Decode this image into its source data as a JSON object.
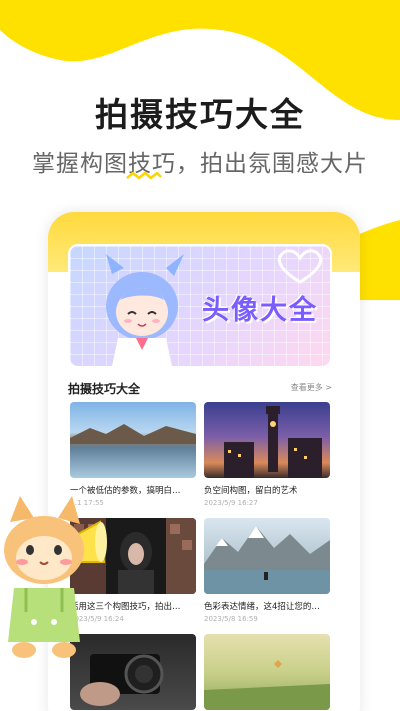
{
  "hero": {
    "title": "拍摄技巧大全",
    "subtitle": "掌握构图技巧，拍出氛围感大片"
  },
  "banner": {
    "text": "头像大全"
  },
  "section": {
    "title": "拍摄技巧大全",
    "more": "查看更多 >"
  },
  "articles": [
    {
      "title": "一个被低估的参数，搞明白…",
      "date": "…1 17:55"
    },
    {
      "title": "负空间构图，留白的艺术",
      "date": "2023/5/9 16:27"
    },
    {
      "title": "活用这三个构图技巧，拍出…",
      "date": "2023/5/9 16:24"
    },
    {
      "title": "色彩表达情绪，这4招让您的…",
      "date": "2023/5/8 16:59"
    },
    {
      "title": "",
      "date": ""
    },
    {
      "title": "",
      "date": ""
    }
  ],
  "colors": {
    "accent": "#ffe100",
    "banner_text": "#7a5cff"
  }
}
